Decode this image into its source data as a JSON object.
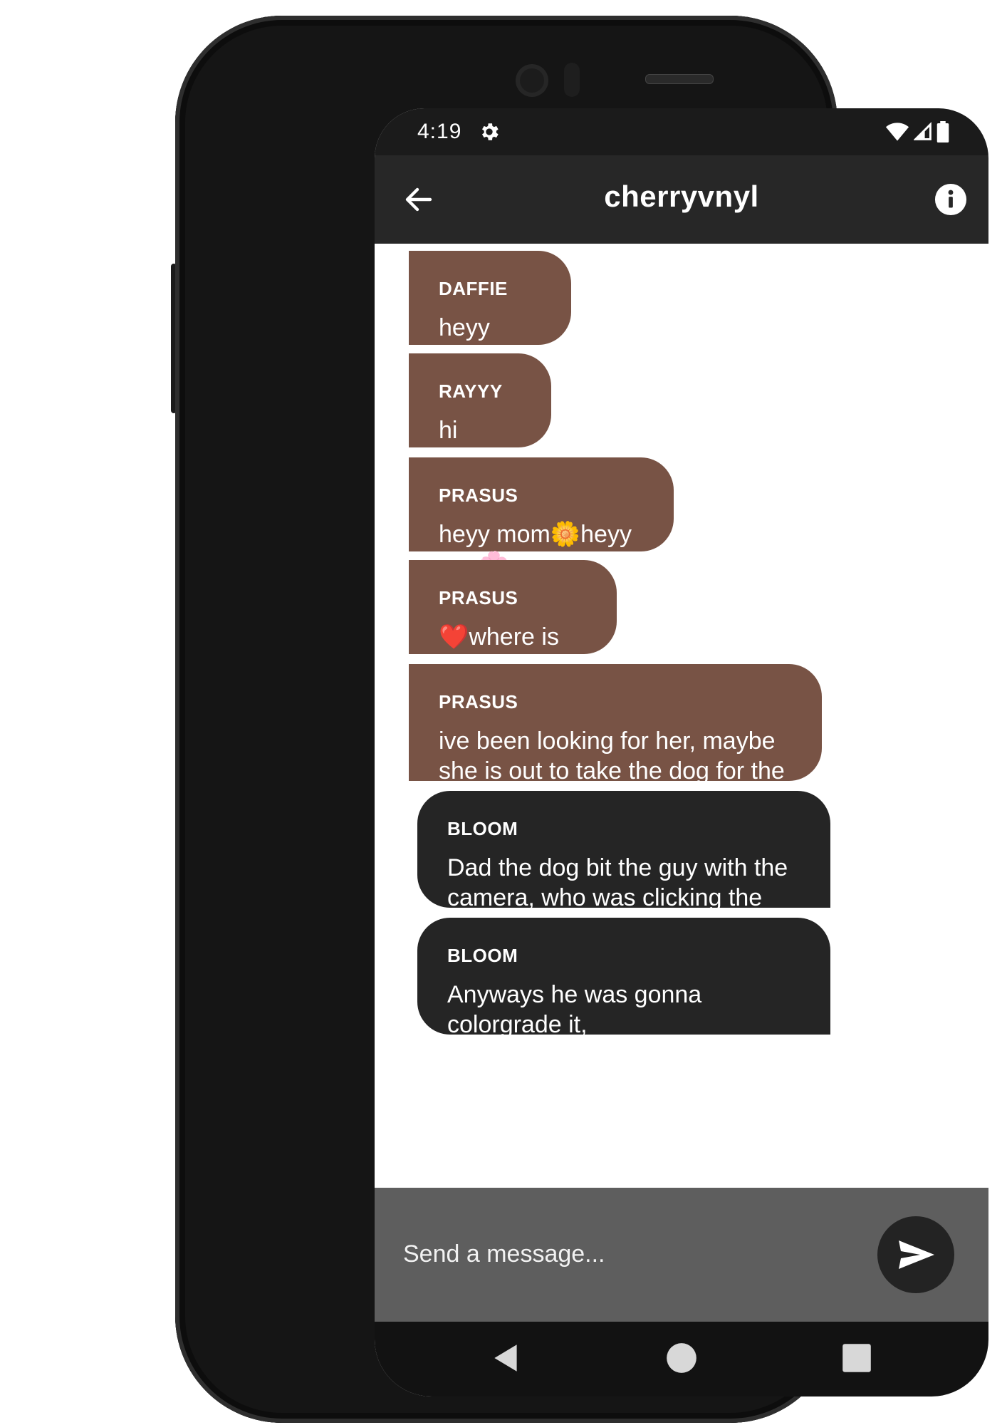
{
  "status_bar": {
    "time": "4:19",
    "icons": [
      "gear-icon",
      "wifi-icon",
      "signal-icon",
      "battery-icon"
    ]
  },
  "app_bar": {
    "title": "cherryvnyl",
    "icons": [
      "back-arrow-icon",
      "info-icon"
    ]
  },
  "messages": [
    {
      "sender": "DAFFIE",
      "text": "heyy rayyy😄",
      "style": "incoming"
    },
    {
      "sender": "RAYYY",
      "text": "hi daffie🥰",
      "style": "incoming"
    },
    {
      "sender": "PRASUS",
      "text": "heyy mom🌼heyy dad🌸",
      "style": "incoming"
    },
    {
      "sender": "PRASUS",
      "text": "❤️where is sister?",
      "style": "incoming"
    },
    {
      "sender": "PRASUS",
      "text": "ive been looking for her, maybe she is out to take the dog for the walk",
      "style": "incoming"
    },
    {
      "sender": "BLOOM",
      "text": "Dad the dog bit the guy with the camera, who was clicking the photo",
      "style": "outgoing"
    },
    {
      "sender": "BLOOM",
      "text": "Anyways he was gonna colorgrade it,",
      "style": "outgoing"
    }
  ],
  "composer": {
    "placeholder": "Send a message...",
    "send_icon": "send-icon"
  },
  "nav_bar": {
    "icons": [
      "nav-back-icon",
      "nav-home-icon",
      "nav-recents-icon"
    ]
  },
  "colors": {
    "incoming_bubble": "#785345",
    "outgoing_bubble": "#252525",
    "app_bar": "#272727",
    "composer": "#5e5e5e"
  }
}
